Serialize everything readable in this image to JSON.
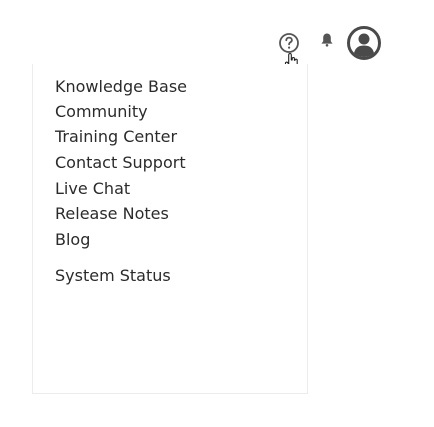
{
  "header": {
    "help_icon": "help-question-icon",
    "notification_icon": "bell-icon",
    "avatar_icon": "user-avatar-icon"
  },
  "menu": {
    "items": [
      {
        "label": "Knowledge Base"
      },
      {
        "label": "Community"
      },
      {
        "label": "Training Center"
      },
      {
        "label": "Contact Support"
      },
      {
        "label": "Live Chat"
      },
      {
        "label": "Release Notes"
      },
      {
        "label": "Blog"
      },
      {
        "label": "System Status"
      }
    ]
  },
  "colors": {
    "text": "#2b2b2b",
    "icon": "#555555",
    "border": "#ececec",
    "background": "#ffffff"
  }
}
